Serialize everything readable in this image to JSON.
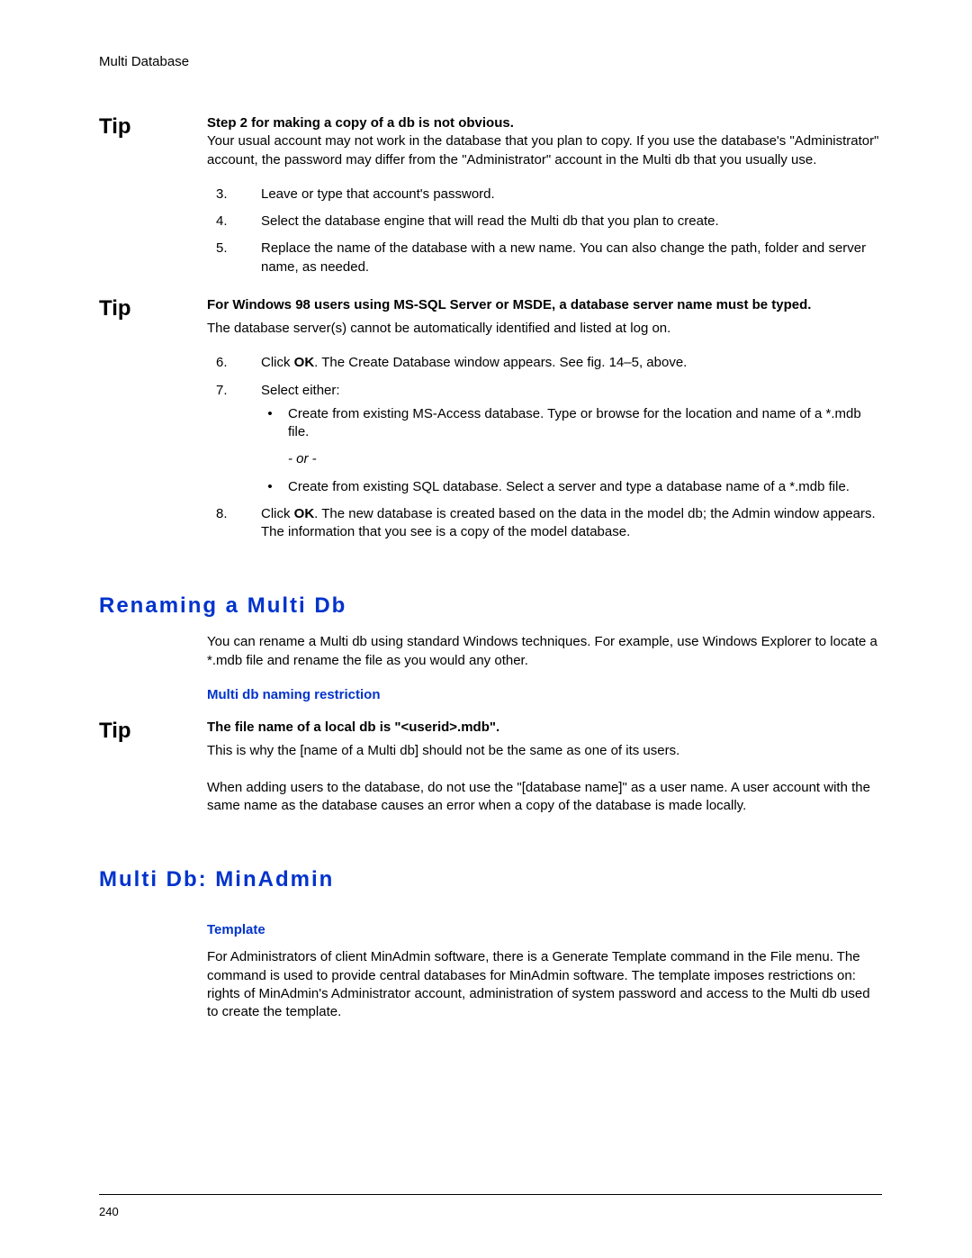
{
  "header": "Multi Database",
  "tip_label": "Tip",
  "tip1": {
    "title": "Step 2 for making a copy of a db is not obvious.",
    "body": "Your usual account may not work in the database that you plan to copy. If you use the database's \"Administrator\" account, the password may differ from the \"Administrator\" account in the Multi db that you usually use."
  },
  "list1": {
    "i3": {
      "n": "3.",
      "t": "Leave or type that account's password."
    },
    "i4": {
      "n": "4.",
      "t": "Select the database engine that will read the Multi db that you plan to create."
    },
    "i5": {
      "n": "5.",
      "t": "Replace the name of the database with a new name. You can also change the path, folder and server name, as needed."
    }
  },
  "tip2": {
    "title": "For Windows 98 users using MS-SQL Server or MSDE, a database server name must be typed.",
    "body": "The database server(s) cannot be automatically identified and listed at log on."
  },
  "list2": {
    "i6": {
      "n": "6.",
      "pre": "Click ",
      "ok": "OK",
      "post": ". The Create Database window appears. See fig. 14–5, above."
    },
    "i7": {
      "n": "7.",
      "t": "Select either:"
    },
    "b1": "Create from existing MS-Access database. Type or browse for the location and name of a *.mdb file.",
    "or": "- or -",
    "b2": "Create from existing SQL database. Select a server and type a database name of a *.mdb file.",
    "i8": {
      "n": "8.",
      "pre": "Click ",
      "ok": "OK",
      "post": ". The new database is created based on the data in the model db; the Admin window appears. The information that you see is a copy of the model database."
    }
  },
  "rename": {
    "heading": "Renaming a Multi Db",
    "body": "You can rename a Multi db using standard Windows techniques. For example, use Windows Explorer to locate a *.mdb file and rename the file as you would any other.",
    "sub": "Multi db naming restriction"
  },
  "tip3": {
    "title": "The file name of a local db is \"<userid>.mdb\".",
    "body1": "This is why the [name of a Multi db] should not be the same as one of its users.",
    "body2": "When adding users to the database, do not use the \"[database name]\" as a user name. A user account with the same name as the database causes an error when a copy of the database is made locally."
  },
  "minadmin": {
    "heading": "Multi Db: MinAdmin",
    "sub": "Template",
    "body": "For Administrators of client MinAdmin software, there is a Generate Template command in the File menu. The command is used to provide central databases for MinAdmin software. The template imposes restrictions on: rights of MinAdmin's Administrator account, administration of system password and access to the Multi db used to create the template."
  },
  "page_number": "240"
}
